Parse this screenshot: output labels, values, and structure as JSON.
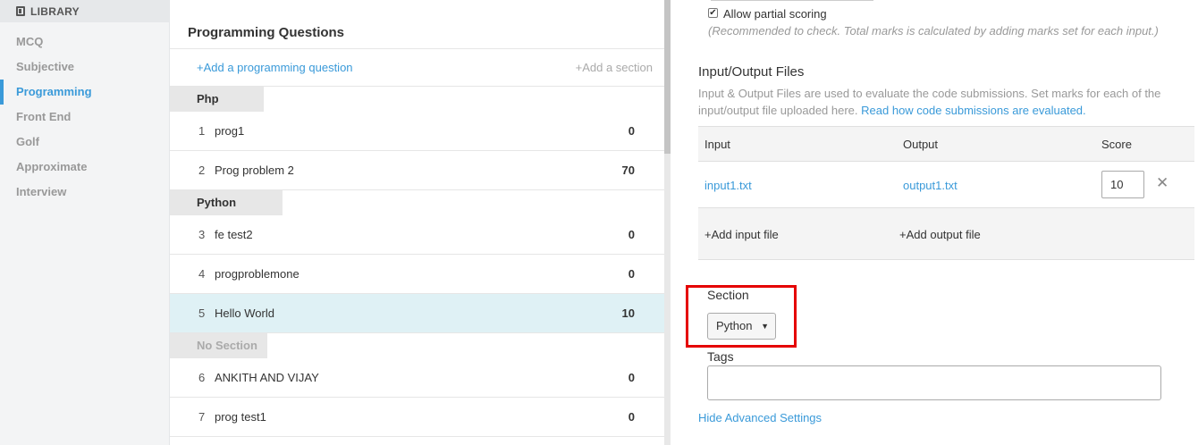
{
  "sidebar": {
    "header": "LIBRARY",
    "header_icon": "book-icon",
    "items": [
      {
        "label": "MCQ"
      },
      {
        "label": "Subjective"
      },
      {
        "label": "Programming",
        "active": true
      },
      {
        "label": "Front End"
      },
      {
        "label": "Golf"
      },
      {
        "label": "Approximate"
      },
      {
        "label": "Interview"
      }
    ]
  },
  "list": {
    "title": "Programming Questions",
    "add_question": "+Add a programming question",
    "add_section": "+Add a section",
    "sections": [
      {
        "name": "Php",
        "questions": [
          {
            "num": "1",
            "name": "prog1",
            "score": "0"
          },
          {
            "num": "2",
            "name": "Prog problem 2",
            "score": "70"
          }
        ]
      },
      {
        "name": "Python",
        "questions": [
          {
            "num": "3",
            "name": "fe test2",
            "score": "0"
          },
          {
            "num": "4",
            "name": "progproblemone",
            "score": "0"
          },
          {
            "num": "5",
            "name": "Hello World",
            "score": "10",
            "selected": true
          }
        ]
      },
      {
        "name": "No Section",
        "questions": [
          {
            "num": "6",
            "name": "ANKITH AND VIJAY",
            "score": "0"
          },
          {
            "num": "7",
            "name": "prog test1",
            "score": "0"
          }
        ]
      }
    ]
  },
  "settings": {
    "partial_scoring_label": "Allow partial scoring",
    "partial_scoring_checked": true,
    "partial_scoring_hint": "(Recommended to check. Total marks is calculated by adding marks set for each input.)",
    "io_title": "Input/Output Files",
    "io_desc": "Input & Output Files are used to evaluate the code submissions. Set marks for each of the input/output file uploaded here.",
    "io_link": "Read how code submissions are evaluated.",
    "io_headers": {
      "input": "Input",
      "output": "Output",
      "score": "Score"
    },
    "io_files": [
      {
        "input": "input1.txt",
        "output": "output1.txt",
        "score": "10"
      }
    ],
    "add_input": "+Add input file",
    "add_output": "+Add output file",
    "section_label": "Section",
    "section_value": "Python",
    "tags_label": "Tags",
    "tags_value": "",
    "hide_advanced": "Hide Advanced Settings"
  },
  "colors": {
    "accent": "#3a9ad9",
    "highlight": "#e50000",
    "selected_row": "#dff1f5"
  }
}
